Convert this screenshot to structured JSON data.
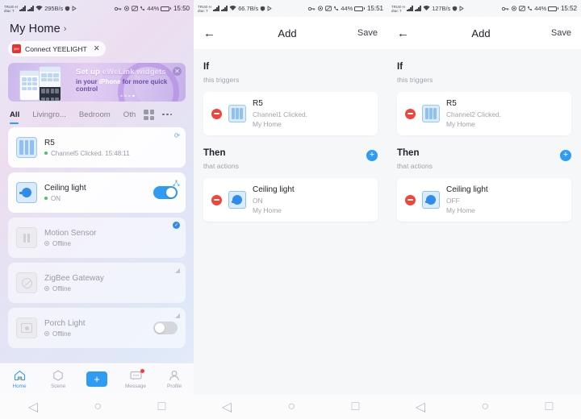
{
  "panels": [
    {
      "id": "home",
      "statusbar": {
        "carrier_line1": "TRUE-H",
        "carrier_line2": "dtac T",
        "net_speed": "295B/s",
        "battery": "44%",
        "clock": "15:50"
      },
      "header": {
        "title": "My Home",
        "chevron": "›"
      },
      "connect_chip": {
        "label": "Connect YEELIGHT",
        "logo": "yeelight-logo",
        "close": "✕"
      },
      "banner": {
        "line1_a": "Set up ",
        "line1_b": "eWeLink widgets",
        "line2_a": "in your ",
        "line2_b": "iPhone",
        "line2_c": " for more quick control",
        "close": "✕",
        "dots": 4,
        "active_dot": 3
      },
      "tabs": [
        {
          "label": "All",
          "active": true
        },
        {
          "label": "Livingro...",
          "active": false
        },
        {
          "label": "Bedroom",
          "active": false
        },
        {
          "label": "Oth",
          "active": false
        }
      ],
      "tab_icons": {
        "grid": "grid-icon",
        "more": "more-icon"
      },
      "devices": [
        {
          "name": "R5",
          "status": "Channel5 Clicked. 15:48:11",
          "state": "online",
          "icon": "switch-panel-icon",
          "control": "none",
          "corner": "sync-icon"
        },
        {
          "name": "Ceiling light",
          "status": "ON",
          "state": "online",
          "icon": "bulb-icon",
          "control": "toggle-on",
          "corner": "share-icon"
        },
        {
          "name": "Motion Sensor",
          "status": "Offline",
          "state": "offline",
          "icon": "sensor-icon",
          "control": "none",
          "corner": "check-badge"
        },
        {
          "name": "ZigBee Gateway",
          "status": "Offline",
          "state": "offline",
          "icon": "gateway-icon",
          "control": "none",
          "corner": "wifi-icon"
        },
        {
          "name": "Porch Light",
          "status": "Offline",
          "state": "offline",
          "icon": "plug-icon",
          "control": "toggle-off",
          "corner": "wifi-icon"
        }
      ],
      "bottom_nav": [
        {
          "label": "Home",
          "icon": "home-icon",
          "active": true
        },
        {
          "label": "Scene",
          "icon": "scene-icon",
          "active": false
        },
        {
          "label": "",
          "icon": "plus-icon",
          "active": false
        },
        {
          "label": "Message",
          "icon": "message-icon",
          "active": false,
          "badge": true
        },
        {
          "label": "Profile",
          "icon": "profile-icon",
          "active": false
        }
      ]
    },
    {
      "id": "add-scene-1",
      "statusbar": {
        "carrier_line1": "TRUE-H",
        "carrier_line2": "dtac T",
        "net_speed": "66.7B/s",
        "battery": "44%",
        "clock": "15:51"
      },
      "header": {
        "back": "←",
        "title": "Add",
        "save": "Save"
      },
      "if_section": {
        "title": "If",
        "subtitle": "this triggers"
      },
      "trigger": {
        "name": "R5",
        "line2": "Channel1 Clicked.",
        "line3": "My Home",
        "icon": "switch-panel-icon",
        "remove": "remove-icon"
      },
      "then_section": {
        "title": "Then",
        "subtitle": "that actions",
        "add": "+"
      },
      "action": {
        "name": "Ceiling light",
        "line2": "ON",
        "line3": "My Home",
        "icon": "bulb-icon",
        "remove": "remove-icon"
      }
    },
    {
      "id": "add-scene-2",
      "statusbar": {
        "carrier_line1": "TRUE-H",
        "carrier_line2": "dtac T",
        "net_speed": "127B/s",
        "battery": "44%",
        "clock": "15:52"
      },
      "header": {
        "back": "←",
        "title": "Add",
        "save": "Save"
      },
      "if_section": {
        "title": "If",
        "subtitle": "this triggers"
      },
      "trigger": {
        "name": "R5",
        "line2": "Channel2 Clicked.",
        "line3": "My Home",
        "icon": "switch-panel-icon",
        "remove": "remove-icon"
      },
      "then_section": {
        "title": "Then",
        "subtitle": "that actions",
        "add": "+"
      },
      "action": {
        "name": "Ceiling light",
        "line2": "OFF",
        "line3": "My Home",
        "icon": "bulb-icon",
        "remove": "remove-icon"
      }
    }
  ],
  "system_nav": {
    "back": "◁",
    "home": "○",
    "recents": "□"
  },
  "colors": {
    "accent": "#2f9bf5",
    "danger": "#f0453b",
    "online": "#4ec26a"
  }
}
